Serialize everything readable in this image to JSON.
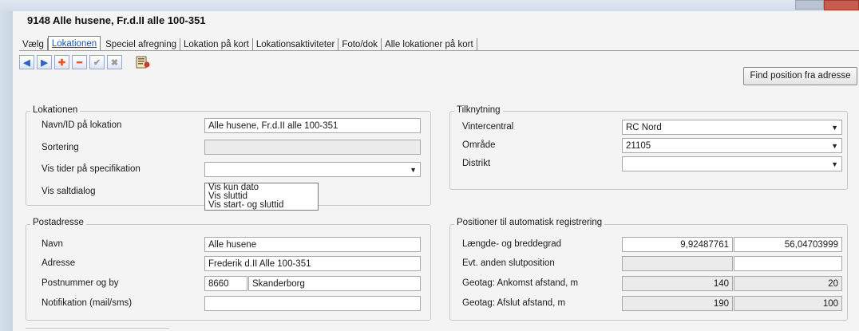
{
  "title": "9148 Alle husene, Fr.d.II alle 100-351",
  "tabs": [
    {
      "label": "Vælg"
    },
    {
      "label": "Lokationen"
    },
    {
      "label": "Speciel afregning"
    },
    {
      "label": "Lokation på kort"
    },
    {
      "label": "Lokationsaktiviteter"
    },
    {
      "label": "Foto/dok"
    },
    {
      "label": "Alle lokationer på kort"
    }
  ],
  "toolbar": {
    "icons": [
      "arrow-left-icon",
      "arrow-right-icon",
      "add-icon",
      "remove-icon",
      "check-icon",
      "cancel-icon",
      "report-icon"
    ],
    "find_button": "Find position fra adresse"
  },
  "lokationen": {
    "legend": "Lokationen",
    "navn_label": "Navn/ID på lokation",
    "navn_value": "Alle husene, Fr.d.II alle 100-351",
    "sortering_label": "Sortering",
    "sortering_value": "",
    "vis_tider_label": "Vis tider på specifikation",
    "vis_tider_value": "",
    "vis_saltdialog_label": "Vis saltdialog",
    "dropdown_options": [
      "Vis kun dato",
      "Vis sluttid",
      "Vis start- og sluttid"
    ]
  },
  "postadresse": {
    "legend": "Postadresse",
    "navn_label": "Navn",
    "navn_value": "Alle husene",
    "adresse_label": "Adresse",
    "adresse_value": "Frederik d.II Alle 100-351",
    "postnr_label": "Postnummer og by",
    "postnr_value": "8660",
    "by_value": "Skanderborg",
    "notifikation_label": "Notifikation (mail/sms)",
    "notifikation_value": ""
  },
  "tilknytning": {
    "legend": "Tilknytning",
    "vintercentral_label": "Vintercentral",
    "vintercentral_value": "RC Nord",
    "omraade_label": "Område",
    "omraade_value": "21105",
    "distrikt_label": "Distrikt",
    "distrikt_value": ""
  },
  "positioner": {
    "legend": "Positioner til automatisk registrering",
    "laengde_label": "Længde- og breddegrad",
    "laengde_value": "9,92487761",
    "bredde_value": "56,04703999",
    "slutposition_label": "Evt. anden slutposition",
    "ankomst_label": "Geotag: Ankomst afstand, m",
    "ankomst_value1": "140",
    "ankomst_value2": "20",
    "afslut_label": "Geotag: Afslut afstand, m",
    "afslut_value1": "190",
    "afslut_value2": "100"
  },
  "colors": {
    "active_tab": "#1b54a8",
    "toolbar_blue": "#2c63c7",
    "toolbar_orange": "#e0561f"
  }
}
